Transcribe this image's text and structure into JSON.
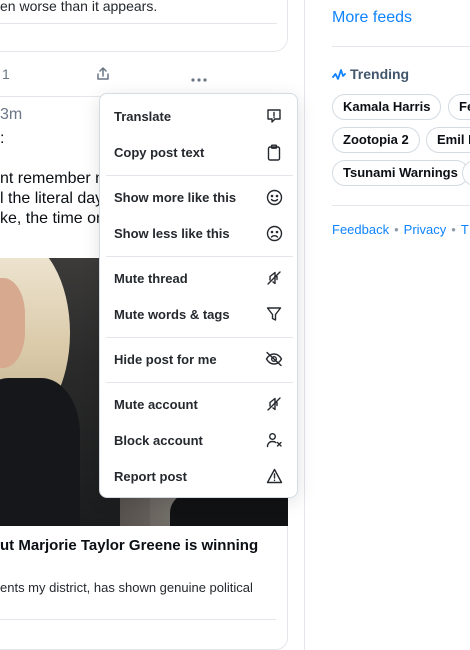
{
  "feed": {
    "top_text": "en worse than it appears.",
    "action_count": "1",
    "post": {
      "timestamp": "3m",
      "lines": [
        ":",
        "",
        "nt remember m",
        "l the literal day",
        "ke, the time or"
      ]
    },
    "link_card": {
      "title": "ut Marjorie Taylor Greene is winning",
      "description": "ents my district, has shown genuine political"
    }
  },
  "sidebar": {
    "more_feeds": "More feeds",
    "trending_title": "Trending",
    "trending_pills": [
      "Kamala Harris",
      "Fe",
      "Zootopia 2",
      "Emil B",
      "Tsunami Warnings",
      "T"
    ],
    "footer_links": [
      "Feedback",
      "Privacy",
      "T"
    ]
  },
  "menu": {
    "items": [
      {
        "label": "Translate",
        "icon": "translate-icon"
      },
      {
        "label": "Copy post text",
        "icon": "clipboard-icon"
      },
      {
        "label": "Show more like this",
        "icon": "smile-icon"
      },
      {
        "label": "Show less like this",
        "icon": "frown-icon"
      },
      {
        "label": "Mute thread",
        "icon": "mute-thread-icon"
      },
      {
        "label": "Mute words & tags",
        "icon": "filter-icon"
      },
      {
        "label": "Hide post for me",
        "icon": "eye-slash-icon"
      },
      {
        "label": "Mute account",
        "icon": "mute-account-icon"
      },
      {
        "label": "Block account",
        "icon": "block-person-icon"
      },
      {
        "label": "Report post",
        "icon": "warning-icon"
      }
    ]
  },
  "colors": {
    "accent": "#1083fe",
    "text": "#0b0f14",
    "muted": "#6a7685",
    "border": "#e3e6ea"
  }
}
